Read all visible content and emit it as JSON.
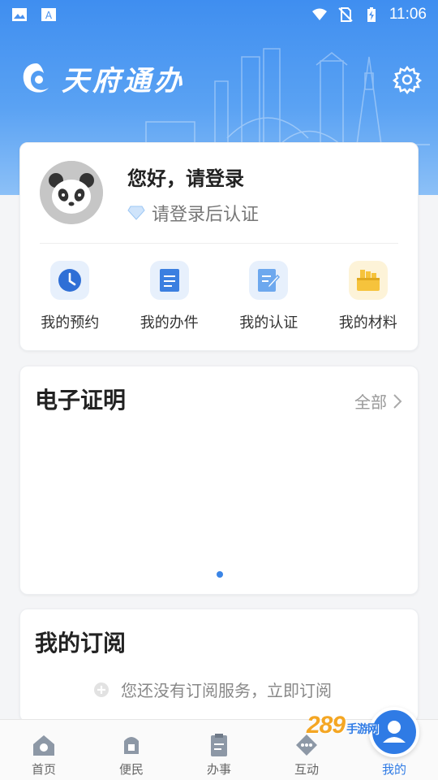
{
  "status_bar": {
    "time": "11:06"
  },
  "header": {
    "app_title": "天府通办"
  },
  "user_card": {
    "greeting": "您好，请登录",
    "verify_hint": "请登录后认证",
    "quick_actions": [
      {
        "label": "我的预约",
        "icon": "clock-icon",
        "color": "#3b7fe0"
      },
      {
        "label": "我的办件",
        "icon": "document-icon",
        "color": "#3b7fe0"
      },
      {
        "label": "我的认证",
        "icon": "edit-document-icon",
        "color": "#6da8ee"
      },
      {
        "label": "我的材料",
        "icon": "folder-icon",
        "color": "#f6c33c"
      }
    ]
  },
  "certificates": {
    "title": "电子证明",
    "more_label": "全部"
  },
  "subscriptions": {
    "title": "我的订阅",
    "empty_text": "您还没有订阅服务，立即订阅"
  },
  "tabbar": {
    "items": [
      {
        "label": "首页",
        "icon": "home-icon"
      },
      {
        "label": "便民",
        "icon": "service-icon"
      },
      {
        "label": "办事",
        "icon": "clipboard-icon"
      },
      {
        "label": "互动",
        "icon": "chat-icon"
      },
      {
        "label": "我的",
        "icon": "profile-icon",
        "active": true
      }
    ]
  },
  "watermark": {
    "text": "289",
    "suffix": "手游网"
  },
  "colors": {
    "primary": "#3f8ef0",
    "accent_blue": "#2f7be5",
    "material_yellow": "#f6c33c"
  }
}
